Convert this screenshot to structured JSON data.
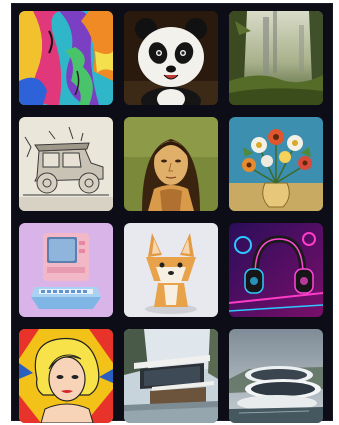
{
  "gallery": {
    "items": [
      {
        "subject": "abstract-painting"
      },
      {
        "subject": "panda"
      },
      {
        "subject": "misty-forest"
      },
      {
        "subject": "vintage-car-sketch"
      },
      {
        "subject": "mona-lisa"
      },
      {
        "subject": "flower-vase"
      },
      {
        "subject": "retro-computer"
      },
      {
        "subject": "shiba-dog"
      },
      {
        "subject": "neon-headphones"
      },
      {
        "subject": "pop-art-portrait"
      },
      {
        "subject": "modern-house"
      },
      {
        "subject": "futuristic-building"
      }
    ]
  },
  "colors": {
    "frame_background": "#0c0d16",
    "page_background": "#ffffff"
  }
}
